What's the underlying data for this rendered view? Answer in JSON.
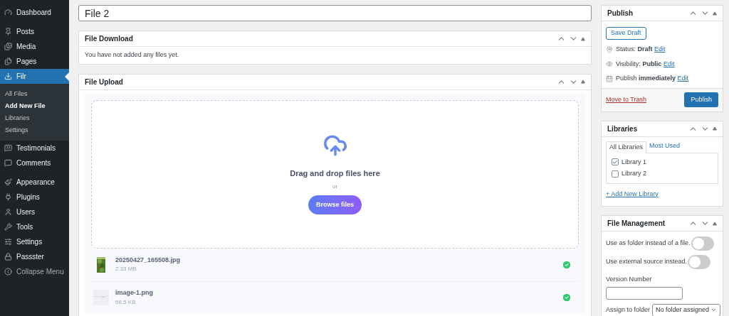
{
  "sidebar": {
    "items": [
      {
        "label": "Dashboard",
        "selected": false
      },
      {
        "label": "Posts",
        "selected": false
      },
      {
        "label": "Media",
        "selected": false
      },
      {
        "label": "Pages",
        "selected": false
      },
      {
        "label": "Filr",
        "selected": true,
        "children": [
          {
            "label": "All Files",
            "selected": false
          },
          {
            "label": "Add New File",
            "selected": true
          },
          {
            "label": "Libraries",
            "selected": false
          },
          {
            "label": "Settings",
            "selected": false
          }
        ]
      },
      {
        "label": "Testimonials",
        "selected": false
      },
      {
        "label": "Comments",
        "selected": false
      },
      {
        "label": "Appearance",
        "selected": false
      },
      {
        "label": "Plugins",
        "selected": false
      },
      {
        "label": "Users",
        "selected": false
      },
      {
        "label": "Tools",
        "selected": false
      },
      {
        "label": "Settings",
        "selected": false
      },
      {
        "label": "Passster",
        "selected": false
      },
      {
        "label": "Collapse Menu",
        "selected": false
      }
    ]
  },
  "title_field": {
    "value": "File 2"
  },
  "file_download": {
    "title": "File Download",
    "message": "You have not added any files yet."
  },
  "file_upload": {
    "title": "File Upload",
    "dropzone": {
      "heading": "Drag and drop files here",
      "separator": "or",
      "button": "Browse files"
    },
    "files": [
      {
        "name": "20250427_165508.jpg",
        "size": "2.33 MB",
        "done": true
      },
      {
        "name": "image-1.png",
        "size": "58.5 KB",
        "kind": "blank",
        "done": true
      }
    ]
  },
  "publish": {
    "title": "Publish",
    "save_draft": "Save Draft",
    "rows": [
      {
        "kind": "status",
        "label": "Status:",
        "value": "Draft",
        "link": "Edit"
      },
      {
        "kind": "visibility",
        "label": "Visibility:",
        "value": "Public",
        "link": "Edit"
      },
      {
        "kind": "schedule",
        "label": "Publish",
        "value": "immediately",
        "link": "Edit"
      }
    ],
    "trash": "Move to Trash",
    "button": "Publish"
  },
  "libraries": {
    "title": "Libraries",
    "tabs": [
      {
        "label": "All Libraries",
        "selected": true
      },
      {
        "label": "Most Used",
        "selected": false
      }
    ],
    "items": [
      {
        "label": "Library 1",
        "checked": true
      },
      {
        "label": "Library 2",
        "checked": false
      }
    ],
    "add_link": "+ Add New Library"
  },
  "file_management": {
    "title": "File Management",
    "toggles": [
      {
        "label": "Use as folder instead of a file.",
        "on": false
      },
      {
        "label": "Use external source instead.",
        "on": false
      }
    ],
    "version_label": "Version Number",
    "folder_label": "Assign to folder",
    "folder_value": "No folder assigned"
  }
}
